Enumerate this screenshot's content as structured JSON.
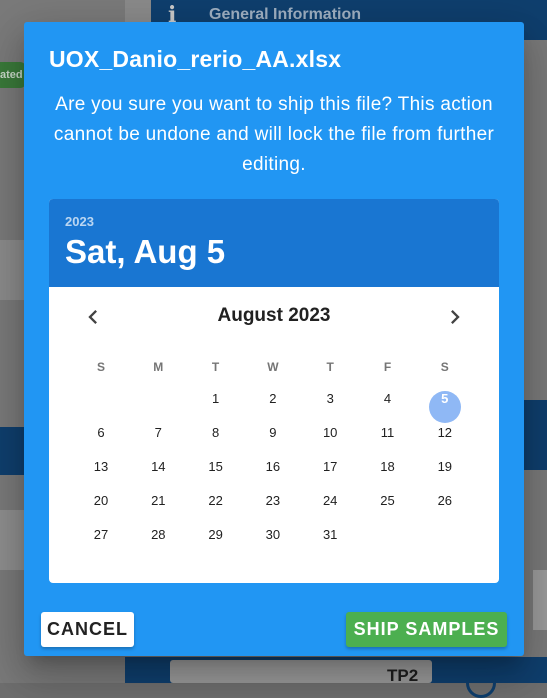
{
  "background": {
    "section_title": "General Information",
    "status_badge": "ated",
    "card_label": "TP2"
  },
  "dialog": {
    "title": "UOX_Danio_rerio_AA.xlsx",
    "message": "Are you sure you want to ship this file? This action cannot be undone and will lock the file from further editing."
  },
  "datepicker": {
    "selected_year": "2023",
    "selected_date": "Sat, Aug 5",
    "month_label": "August 2023",
    "weekdays": [
      "S",
      "M",
      "T",
      "W",
      "T",
      "F",
      "S"
    ],
    "first_weekday_index": 2,
    "days_in_month": 31,
    "selected_day": 5
  },
  "actions": {
    "cancel_label": "CANCEL",
    "ship_label": "SHIP SAMPLES"
  },
  "colors": {
    "dialog_bg": "#2196f3",
    "header_bg": "#1976d2",
    "selected_day_bg": "#8fb8f5",
    "ship_button_bg": "#4caf50"
  }
}
